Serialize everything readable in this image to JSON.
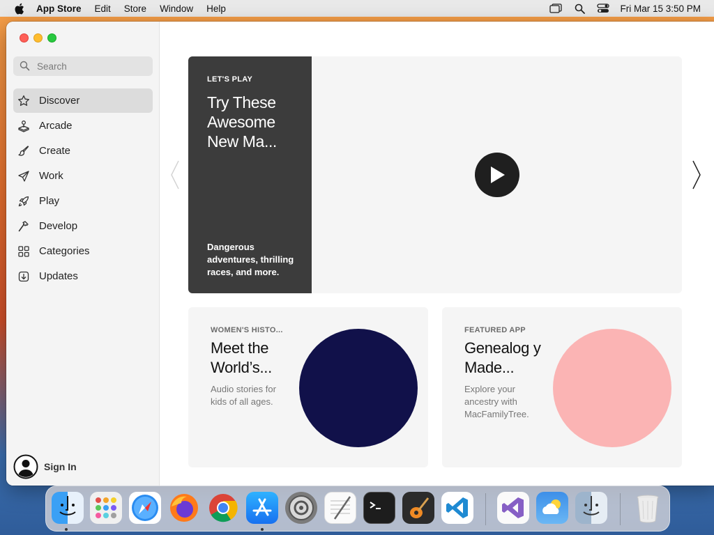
{
  "menubar": {
    "app_name": "App Store",
    "menus": [
      "Edit",
      "Store",
      "Window",
      "Help"
    ],
    "clock": "Fri Mar 15  3:50 PM"
  },
  "sidebar": {
    "search": {
      "placeholder": "Search"
    },
    "items": [
      {
        "label": "Discover",
        "icon": "star-icon",
        "selected": true
      },
      {
        "label": "Arcade",
        "icon": "joystick-icon"
      },
      {
        "label": "Create",
        "icon": "brush-icon"
      },
      {
        "label": "Work",
        "icon": "paper-plane-icon"
      },
      {
        "label": "Play",
        "icon": "rocket-icon"
      },
      {
        "label": "Develop",
        "icon": "hammer-icon"
      },
      {
        "label": "Categories",
        "icon": "grid-icon"
      },
      {
        "label": "Updates",
        "icon": "download-icon"
      }
    ],
    "sign_in": "Sign In"
  },
  "hero": {
    "eyebrow": "LET'S PLAY",
    "title": "Try These Awesome New Ma...",
    "subtitle": "Dangerous adventures, thrilling races, and more."
  },
  "cards": [
    {
      "eyebrow": "WOMEN'S HISTO...",
      "title": "Meet the World’s...",
      "subtitle": "Audio stories for kids of all ages.",
      "color": "#11114a"
    },
    {
      "eyebrow": "FEATURED APP",
      "title": "Genealog y Made...",
      "subtitle": "Explore your ancestry with MacFamilyTree.",
      "color": "#fbb4b4"
    }
  ],
  "dock": {
    "apps": [
      "Finder",
      "Launchpad",
      "Safari",
      "Firefox",
      "Chrome",
      "App Store",
      "System Preferences",
      "TextEdit",
      "Terminal",
      "GarageBand",
      "VS Code",
      "Visual Studio",
      "Weather",
      "Finder Alt",
      "Trash"
    ]
  }
}
